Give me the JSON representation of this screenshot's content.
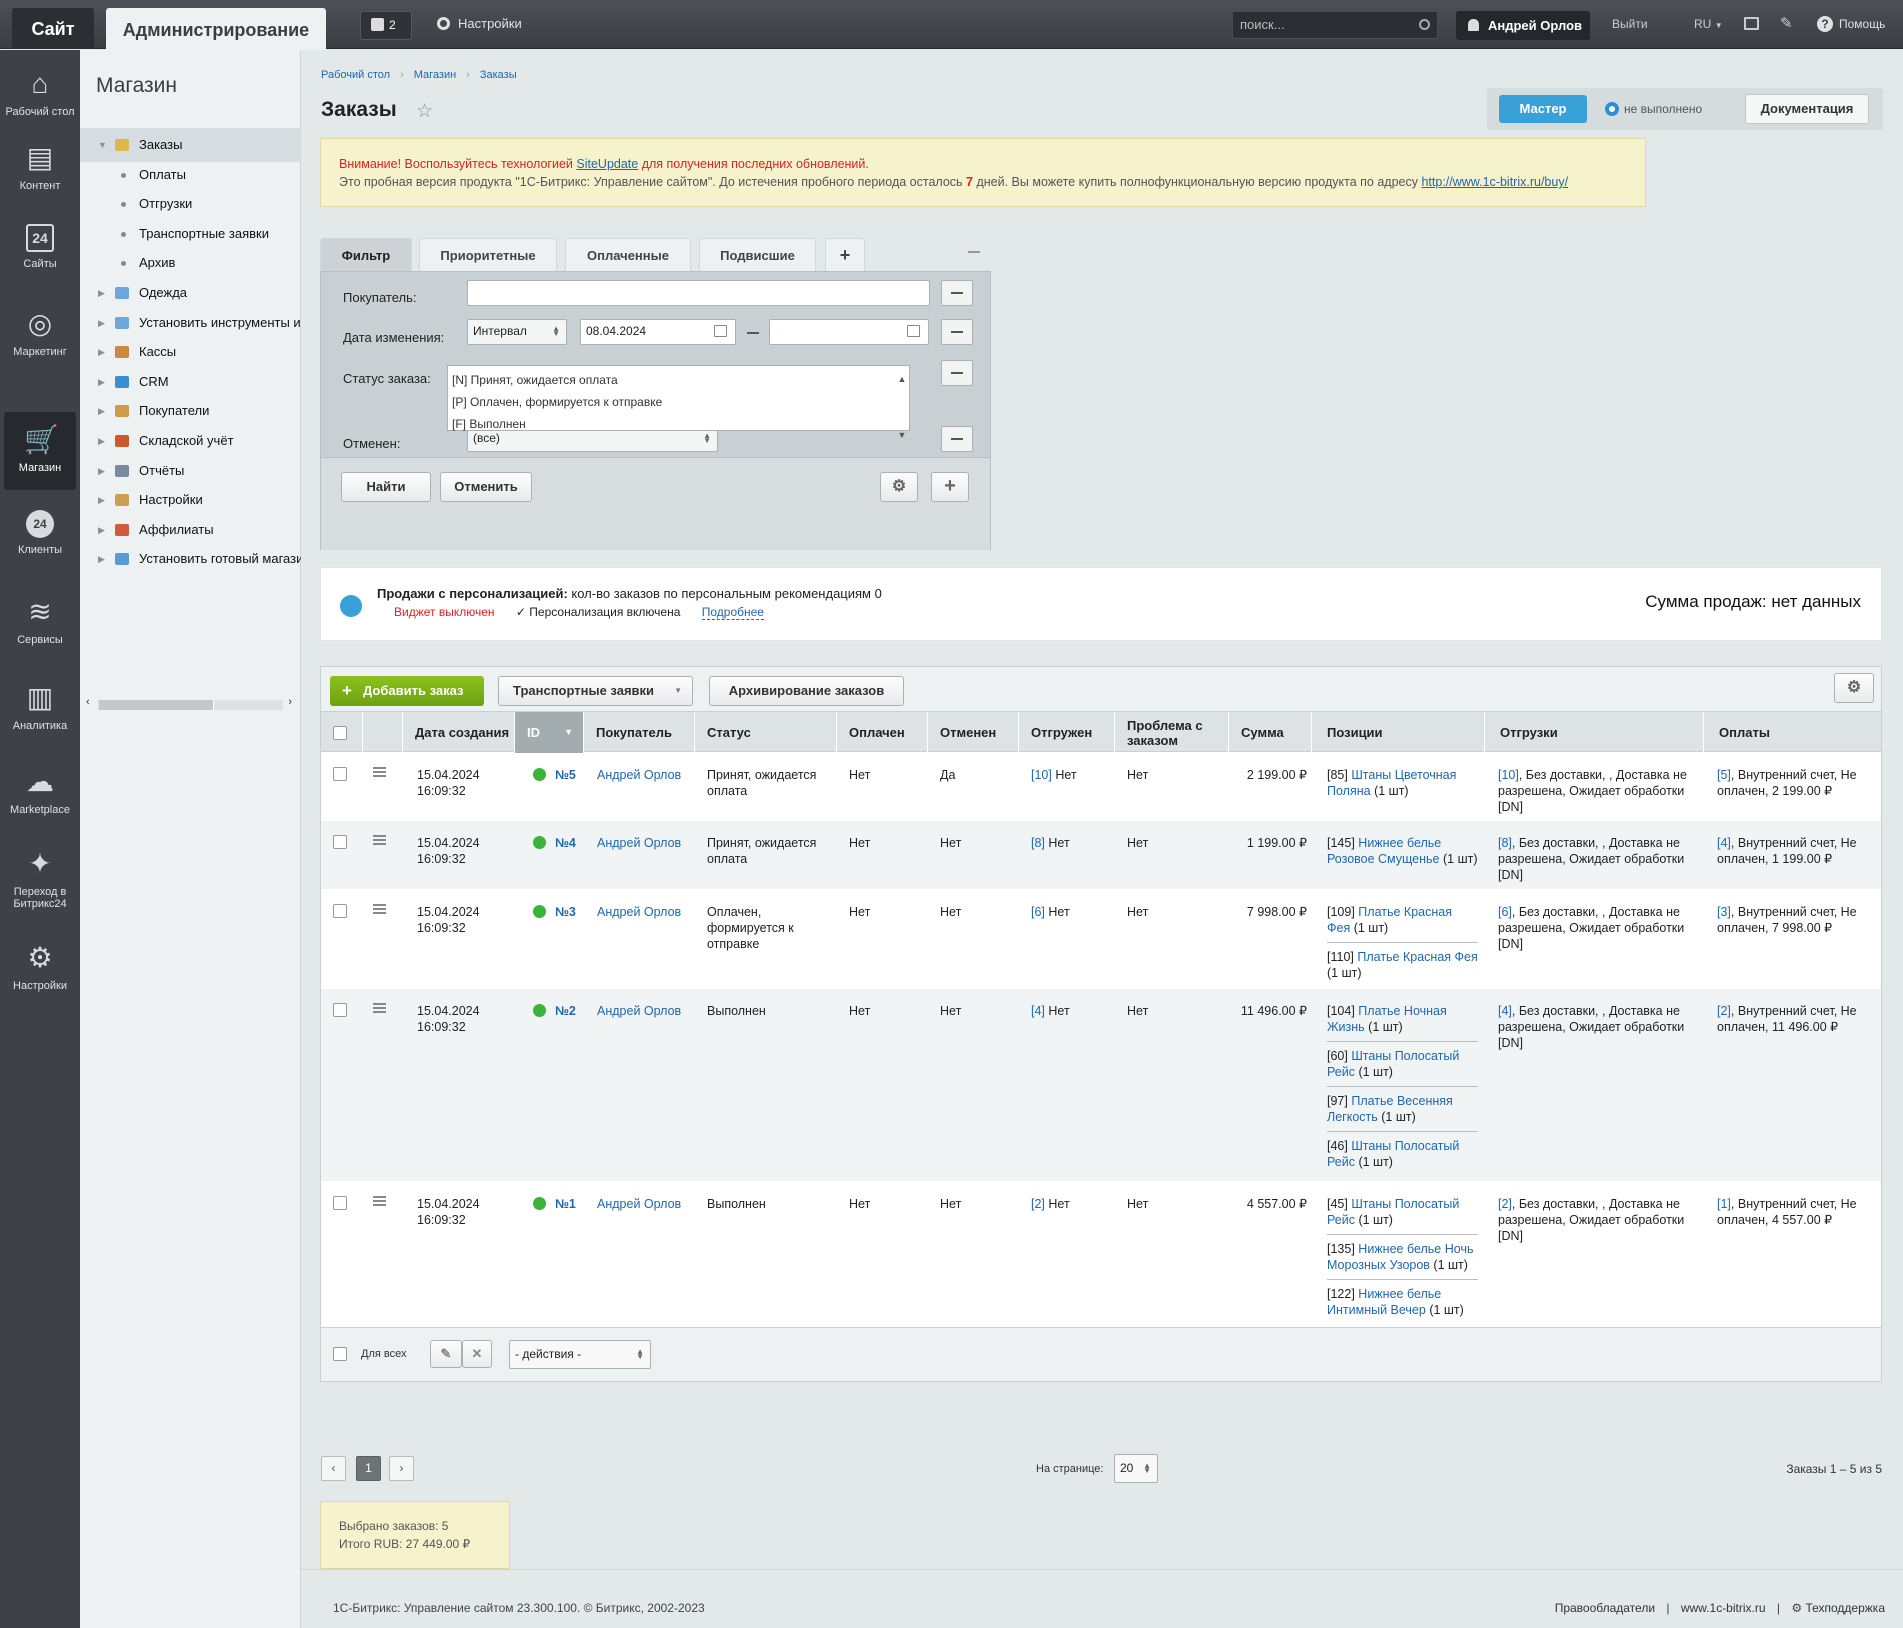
{
  "topbar": {
    "site_tab": "Сайт",
    "admin_tab": "Администрирование",
    "notifications_count": "2",
    "settings": "Настройки",
    "search_placeholder": "поиск...",
    "user": "Андрей Орлов",
    "logout": "Выйти",
    "lang": "RU",
    "help": "Помощь"
  },
  "iconbar": [
    {
      "label": "Рабочий стол",
      "icon": "home-icon"
    },
    {
      "label": "Контент",
      "icon": "document-icon"
    },
    {
      "label": "Сайты",
      "icon": "calendar-24-icon"
    },
    {
      "label": "Маркетинг",
      "icon": "target-icon"
    },
    {
      "label": "Магазин",
      "icon": "basket-icon"
    },
    {
      "label": "Клиенты",
      "icon": "clients-24-icon"
    },
    {
      "label": "Сервисы",
      "icon": "layers-icon"
    },
    {
      "label": "Аналитика",
      "icon": "bar-chart-icon"
    },
    {
      "label": "Marketplace",
      "icon": "cloud-download-icon"
    },
    {
      "label": "Переход в Битрикс24",
      "icon": "magic-wand-icon"
    },
    {
      "label": "Настройки",
      "icon": "gear-icon"
    }
  ],
  "menu": {
    "title": "Магазин",
    "items": [
      {
        "label": "Заказы",
        "level": 0,
        "arrow": "▼",
        "color": "#e0b84a"
      },
      {
        "label": "Оплаты",
        "level": 1
      },
      {
        "label": "Отгрузки",
        "level": 1
      },
      {
        "label": "Транспортные заявки",
        "level": 1
      },
      {
        "label": "Архив",
        "level": 1
      },
      {
        "label": "Одежда",
        "level": 0,
        "arrow": "▶",
        "color": "#6ea6de"
      },
      {
        "label": "Установить инструменты из",
        "level": 0,
        "arrow": "▶",
        "color": "#6ea6de"
      },
      {
        "label": "Кассы",
        "level": 0,
        "arrow": "▶",
        "color": "#c98a3a"
      },
      {
        "label": "CRM",
        "level": 0,
        "arrow": "▶",
        "color": "#3a8fcc"
      },
      {
        "label": "Покупатели",
        "level": 0,
        "arrow": "▶",
        "color": "#d09a48"
      },
      {
        "label": "Складской учёт",
        "level": 0,
        "arrow": "▶",
        "color": "#cc5a2a"
      },
      {
        "label": "Отчёты",
        "level": 0,
        "arrow": "▶",
        "color": "#7a8aa0"
      },
      {
        "label": "Настройки",
        "level": 0,
        "arrow": "▶",
        "color": "#c9a050"
      },
      {
        "label": "Аффилиаты",
        "level": 0,
        "arrow": "▶",
        "color": "#d05a40"
      },
      {
        "label": "Установить готовый магази",
        "level": 0,
        "arrow": "▶",
        "color": "#5a9ad0"
      }
    ]
  },
  "breadcrumb": [
    "Рабочий стол",
    "Магазин",
    "Заказы"
  ],
  "page_title": "Заказы",
  "master": {
    "label": "Мастер",
    "status": "не выполнено",
    "doc": "Документация"
  },
  "warning": {
    "line1_a": "Внимание! Воспользуйтесь технологией ",
    "line1_link": "SiteUpdate",
    "line1_b": " для получения последних обновлений.",
    "line2_a": "Это пробная версия продукта \"1С-Битрикс: Управление сайтом\". До истечения пробного периода осталось ",
    "line2_days": "7",
    "line2_b": " дней. Вы можете купить полнофункциональную версию продукта по адресу ",
    "line2_link": "http://www.1c-bitrix.ru/buy/"
  },
  "filter": {
    "tabs": [
      "Фильтр",
      "Приоритетные",
      "Оплаченные",
      "Подвисшие"
    ],
    "buyer_label": "Покупатель:",
    "buyer_value": "",
    "date_label": "Дата изменения:",
    "date_mode": "Интервал",
    "date_from": "08.04.2024",
    "date_to": "",
    "status_label": "Статус заказа:",
    "status_options": [
      "[N] Принят, ожидается оплата",
      "[P] Оплачен, формируется к отправке",
      "[F] Выполнен"
    ],
    "canceled_label": "Отменен:",
    "canceled_value": "(все)",
    "find": "Найти",
    "cancel": "Отменить"
  },
  "personalization": {
    "title": "Продажи с персонализацией:",
    "desc": "кол-во заказов по персональным рекомендациям 0",
    "widget_off": "Виджет выключен",
    "enabled": "Персонализация включена",
    "more": "Подробнее",
    "sum": "Сумма продаж: нет данных"
  },
  "toolbar": {
    "add": "Добавить заказ",
    "transport": "Транспортные заявки",
    "archive": "Архивирование заказов"
  },
  "columns": [
    "Дата создания",
    "ID",
    "Покупатель",
    "Статус",
    "Оплачен",
    "Отменен",
    "Отгружен",
    "Проблема с заказом",
    "Сумма",
    "Позиции",
    "Отгрузки",
    "Оплаты"
  ],
  "orders": [
    {
      "date": "15.04.2024",
      "time": "16:09:32",
      "id": "№5",
      "buyer": "Андрей Орлов",
      "status": "Принят, ожидается оплата",
      "paid": "Нет",
      "canceled": "Да",
      "ship_id": "[10]",
      "shipped": "Нет",
      "problem": "Нет",
      "sum": "2 199.00 ₽",
      "positions": [
        {
          "num": "[85]",
          "name": "Штаны Цветочная Поляна",
          "qty": "(1 шт)"
        }
      ],
      "shipment_id": "[10]",
      "shipment": ", Без доставки, , Доставка не разрешена, Ожидает обработки [DN]",
      "payment_id": "[5]",
      "payment": ", Внутренний счет, Не оплачен, 2 199.00 ₽"
    },
    {
      "date": "15.04.2024",
      "time": "16:09:32",
      "id": "№4",
      "buyer": "Андрей Орлов",
      "status": "Принят, ожидается оплата",
      "paid": "Нет",
      "canceled": "Нет",
      "ship_id": "[8]",
      "shipped": "Нет",
      "problem": "Нет",
      "sum": "1 199.00 ₽",
      "positions": [
        {
          "num": "[145]",
          "name": "Нижнее белье Розовое Смущенье",
          "qty": "(1 шт)"
        }
      ],
      "shipment_id": "[8]",
      "shipment": ", Без доставки, , Доставка не разрешена, Ожидает обработки [DN]",
      "payment_id": "[4]",
      "payment": ", Внутренний счет, Не оплачен, 1 199.00 ₽"
    },
    {
      "date": "15.04.2024",
      "time": "16:09:32",
      "id": "№3",
      "buyer": "Андрей Орлов",
      "status": "Оплачен, формируется к отправке",
      "paid": "Нет",
      "canceled": "Нет",
      "ship_id": "[6]",
      "shipped": "Нет",
      "problem": "Нет",
      "sum": "7 998.00 ₽",
      "positions": [
        {
          "num": "[109]",
          "name": "Платье Красная Фея",
          "qty": "(1 шт)"
        },
        {
          "num": "[110]",
          "name": "Платье Красная Фея",
          "qty": "(1 шт)"
        }
      ],
      "shipment_id": "[6]",
      "shipment": ", Без доставки, , Доставка не разрешена, Ожидает обработки [DN]",
      "payment_id": "[3]",
      "payment": ", Внутренний счет, Не оплачен, 7 998.00 ₽"
    },
    {
      "date": "15.04.2024",
      "time": "16:09:32",
      "id": "№2",
      "buyer": "Андрей Орлов",
      "status": "Выполнен",
      "paid": "Нет",
      "canceled": "Нет",
      "ship_id": "[4]",
      "shipped": "Нет",
      "problem": "Нет",
      "sum": "11 496.00 ₽",
      "positions": [
        {
          "num": "[104]",
          "name": "Платье Ночная Жизнь",
          "qty": "(1 шт)"
        },
        {
          "num": "[60]",
          "name": "Штаны Полосатый Рейс",
          "qty": "(1 шт)"
        },
        {
          "num": "[97]",
          "name": "Платье Весенняя Легкость",
          "qty": "(1 шт)"
        },
        {
          "num": "[46]",
          "name": "Штаны Полосатый Рейс",
          "qty": "(1 шт)"
        }
      ],
      "shipment_id": "[4]",
      "shipment": ", Без доставки, , Доставка не разрешена, Ожидает обработки [DN]",
      "payment_id": "[2]",
      "payment": ", Внутренний счет, Не оплачен, 11 496.00 ₽"
    },
    {
      "date": "15.04.2024",
      "time": "16:09:32",
      "id": "№1",
      "buyer": "Андрей Орлов",
      "status": "Выполнен",
      "paid": "Нет",
      "canceled": "Нет",
      "ship_id": "[2]",
      "shipped": "Нет",
      "problem": "Нет",
      "sum": "4 557.00 ₽",
      "positions": [
        {
          "num": "[45]",
          "name": "Штаны Полосатый Рейс",
          "qty": "(1 шт)"
        },
        {
          "num": "[135]",
          "name": "Нижнее белье Ночь Морозных Узоров",
          "qty": "(1 шт)"
        },
        {
          "num": "[122]",
          "name": "Нижнее белье Интимный Вечер",
          "qty": "(1 шт)"
        }
      ],
      "shipment_id": "[2]",
      "shipment": ", Без доставки, , Доставка не разрешена, Ожидает обработки [DN]",
      "payment_id": "[1]",
      "payment": ", Внутренний счет, Не оплачен, 4 557.00 ₽"
    }
  ],
  "table_footer": {
    "for_all": "Для всех",
    "actions": "- действия -"
  },
  "pager": {
    "page": "1",
    "per_page_label": "На странице:",
    "per_page": "20",
    "range": "Заказы 1 – 5 из 5"
  },
  "summary": {
    "selected": "Выбрано заказов: 5",
    "total": "Итого RUB: 27 449.00 ₽"
  },
  "footer": {
    "left": "1С-Битрикс: Управление сайтом 23.300.100. © Битрикс, 2002-2023",
    "owners": "Правообладатели",
    "site": "www.1c-bitrix.ru",
    "support": "Техподдержка"
  },
  "colors": {
    "accent": "#3aa1d8",
    "add_button": "#7cb316",
    "status_dot": "#3bb33b",
    "warning_bg": "#f6f2cb"
  }
}
